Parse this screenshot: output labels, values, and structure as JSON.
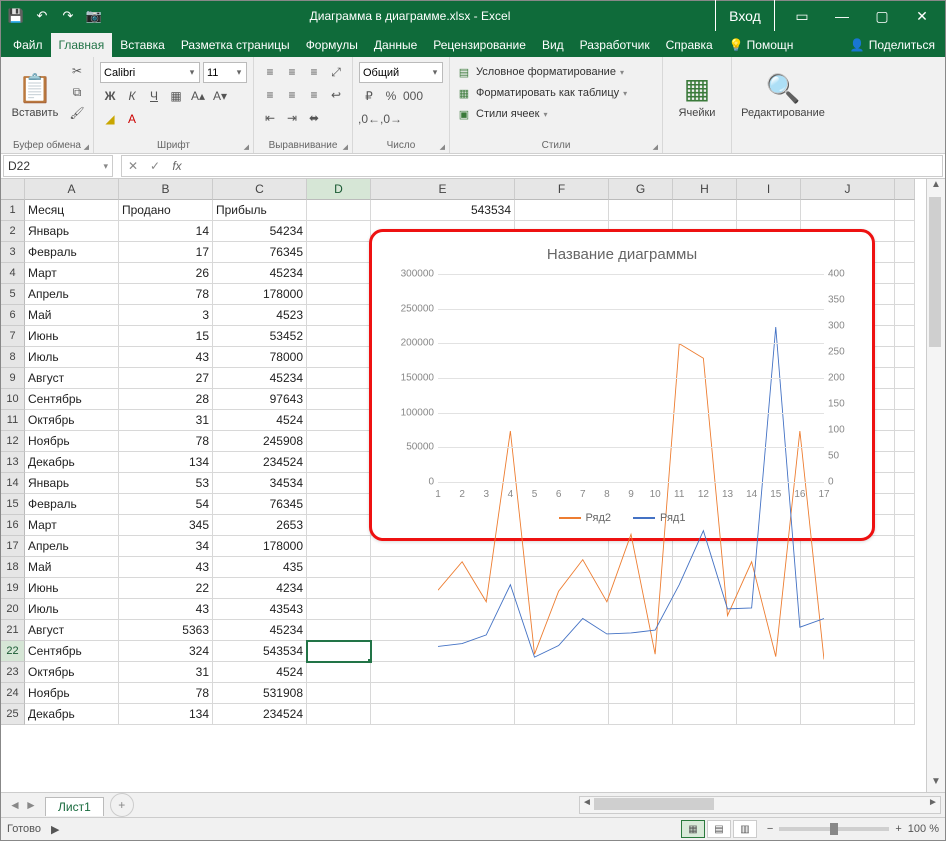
{
  "app": {
    "title": "Диаграмма в диаграмме.xlsx - Excel",
    "login": "Вход"
  },
  "tabs": {
    "items": [
      "Файл",
      "Главная",
      "Вставка",
      "Разметка страницы",
      "Формулы",
      "Данные",
      "Рецензирование",
      "Вид",
      "Разработчик",
      "Справка"
    ],
    "help": "Помощн",
    "share": "Поделиться"
  },
  "ribbon": {
    "clipboard": {
      "label": "Буфер обмена",
      "paste": "Вставить"
    },
    "font": {
      "label": "Шрифт",
      "name": "Calibri",
      "size": "11"
    },
    "align": {
      "label": "Выравнивание"
    },
    "number": {
      "label": "Число",
      "format": "Общий"
    },
    "styles": {
      "label": "Стили",
      "cond": "Условное форматирование",
      "table": "Форматировать как таблицу",
      "cell": "Стили ячеек"
    },
    "cells": {
      "label": "Ячейки"
    },
    "editing": {
      "label": "Редактирование"
    }
  },
  "namebox": "D22",
  "columns": [
    "A",
    "B",
    "C",
    "D",
    "E",
    "F",
    "G",
    "H",
    "I",
    "J"
  ],
  "table": {
    "headers": [
      "Месяц",
      "Продано",
      "Прибыль"
    ],
    "rows": [
      [
        "Январь",
        "14",
        "54234"
      ],
      [
        "Февраль",
        "17",
        "76345"
      ],
      [
        "Март",
        "26",
        "45234"
      ],
      [
        "Апрель",
        "78",
        "178000"
      ],
      [
        "Май",
        "3",
        "4523"
      ],
      [
        "Июнь",
        "15",
        "53452"
      ],
      [
        "Июль",
        "43",
        "78000"
      ],
      [
        "Август",
        "27",
        "45234"
      ],
      [
        "Сентябрь",
        "28",
        "97643"
      ],
      [
        "Октябрь",
        "31",
        "4524"
      ],
      [
        "Ноябрь",
        "78",
        "245908"
      ],
      [
        "Декабрь",
        "134",
        "234524"
      ],
      [
        "Январь",
        "53",
        "34534"
      ],
      [
        "Февраль",
        "54",
        "76345"
      ],
      [
        "Март",
        "345",
        "2653"
      ],
      [
        "Апрель",
        "34",
        "178000"
      ],
      [
        "Май",
        "43",
        "435"
      ],
      [
        "Июнь",
        "22",
        "4234"
      ],
      [
        "Июль",
        "43",
        "43543"
      ],
      [
        "Август",
        "5363",
        "45234"
      ],
      [
        "Сентябрь",
        "324",
        "543534"
      ],
      [
        "Октябрь",
        "31",
        "4524"
      ],
      [
        "Ноябрь",
        "78",
        "531908"
      ],
      [
        "Декабрь",
        "134",
        "234524"
      ]
    ],
    "extra": {
      "E1": "543534"
    }
  },
  "sheet": {
    "name": "Лист1"
  },
  "status": {
    "ready": "Готово",
    "zoom": "100 %"
  },
  "chart_data": {
    "type": "line",
    "title": "Название диаграммы",
    "x": [
      1,
      2,
      3,
      4,
      5,
      6,
      7,
      8,
      9,
      10,
      11,
      12,
      13,
      14,
      15,
      16,
      17
    ],
    "series": [
      {
        "name": "Ряд2",
        "color": "#ed7d31",
        "axis": "left",
        "values": [
          54234,
          76345,
          45234,
          178000,
          4523,
          53452,
          78000,
          45234,
          97643,
          4524,
          245908,
          234524,
          34534,
          76345,
          2653,
          178000,
          435
        ]
      },
      {
        "name": "Ряд1",
        "color": "#4472c4",
        "axis": "right",
        "values": [
          14,
          17,
          26,
          78,
          3,
          15,
          43,
          27,
          28,
          31,
          78,
          134,
          53,
          54,
          345,
          34,
          43
        ]
      }
    ],
    "y_left": {
      "min": 0,
      "max": 300000,
      "step": 50000
    },
    "y_right": {
      "min": 0,
      "max": 400,
      "step": 50
    },
    "legend": [
      "Ряд2",
      "Ряд1"
    ]
  }
}
